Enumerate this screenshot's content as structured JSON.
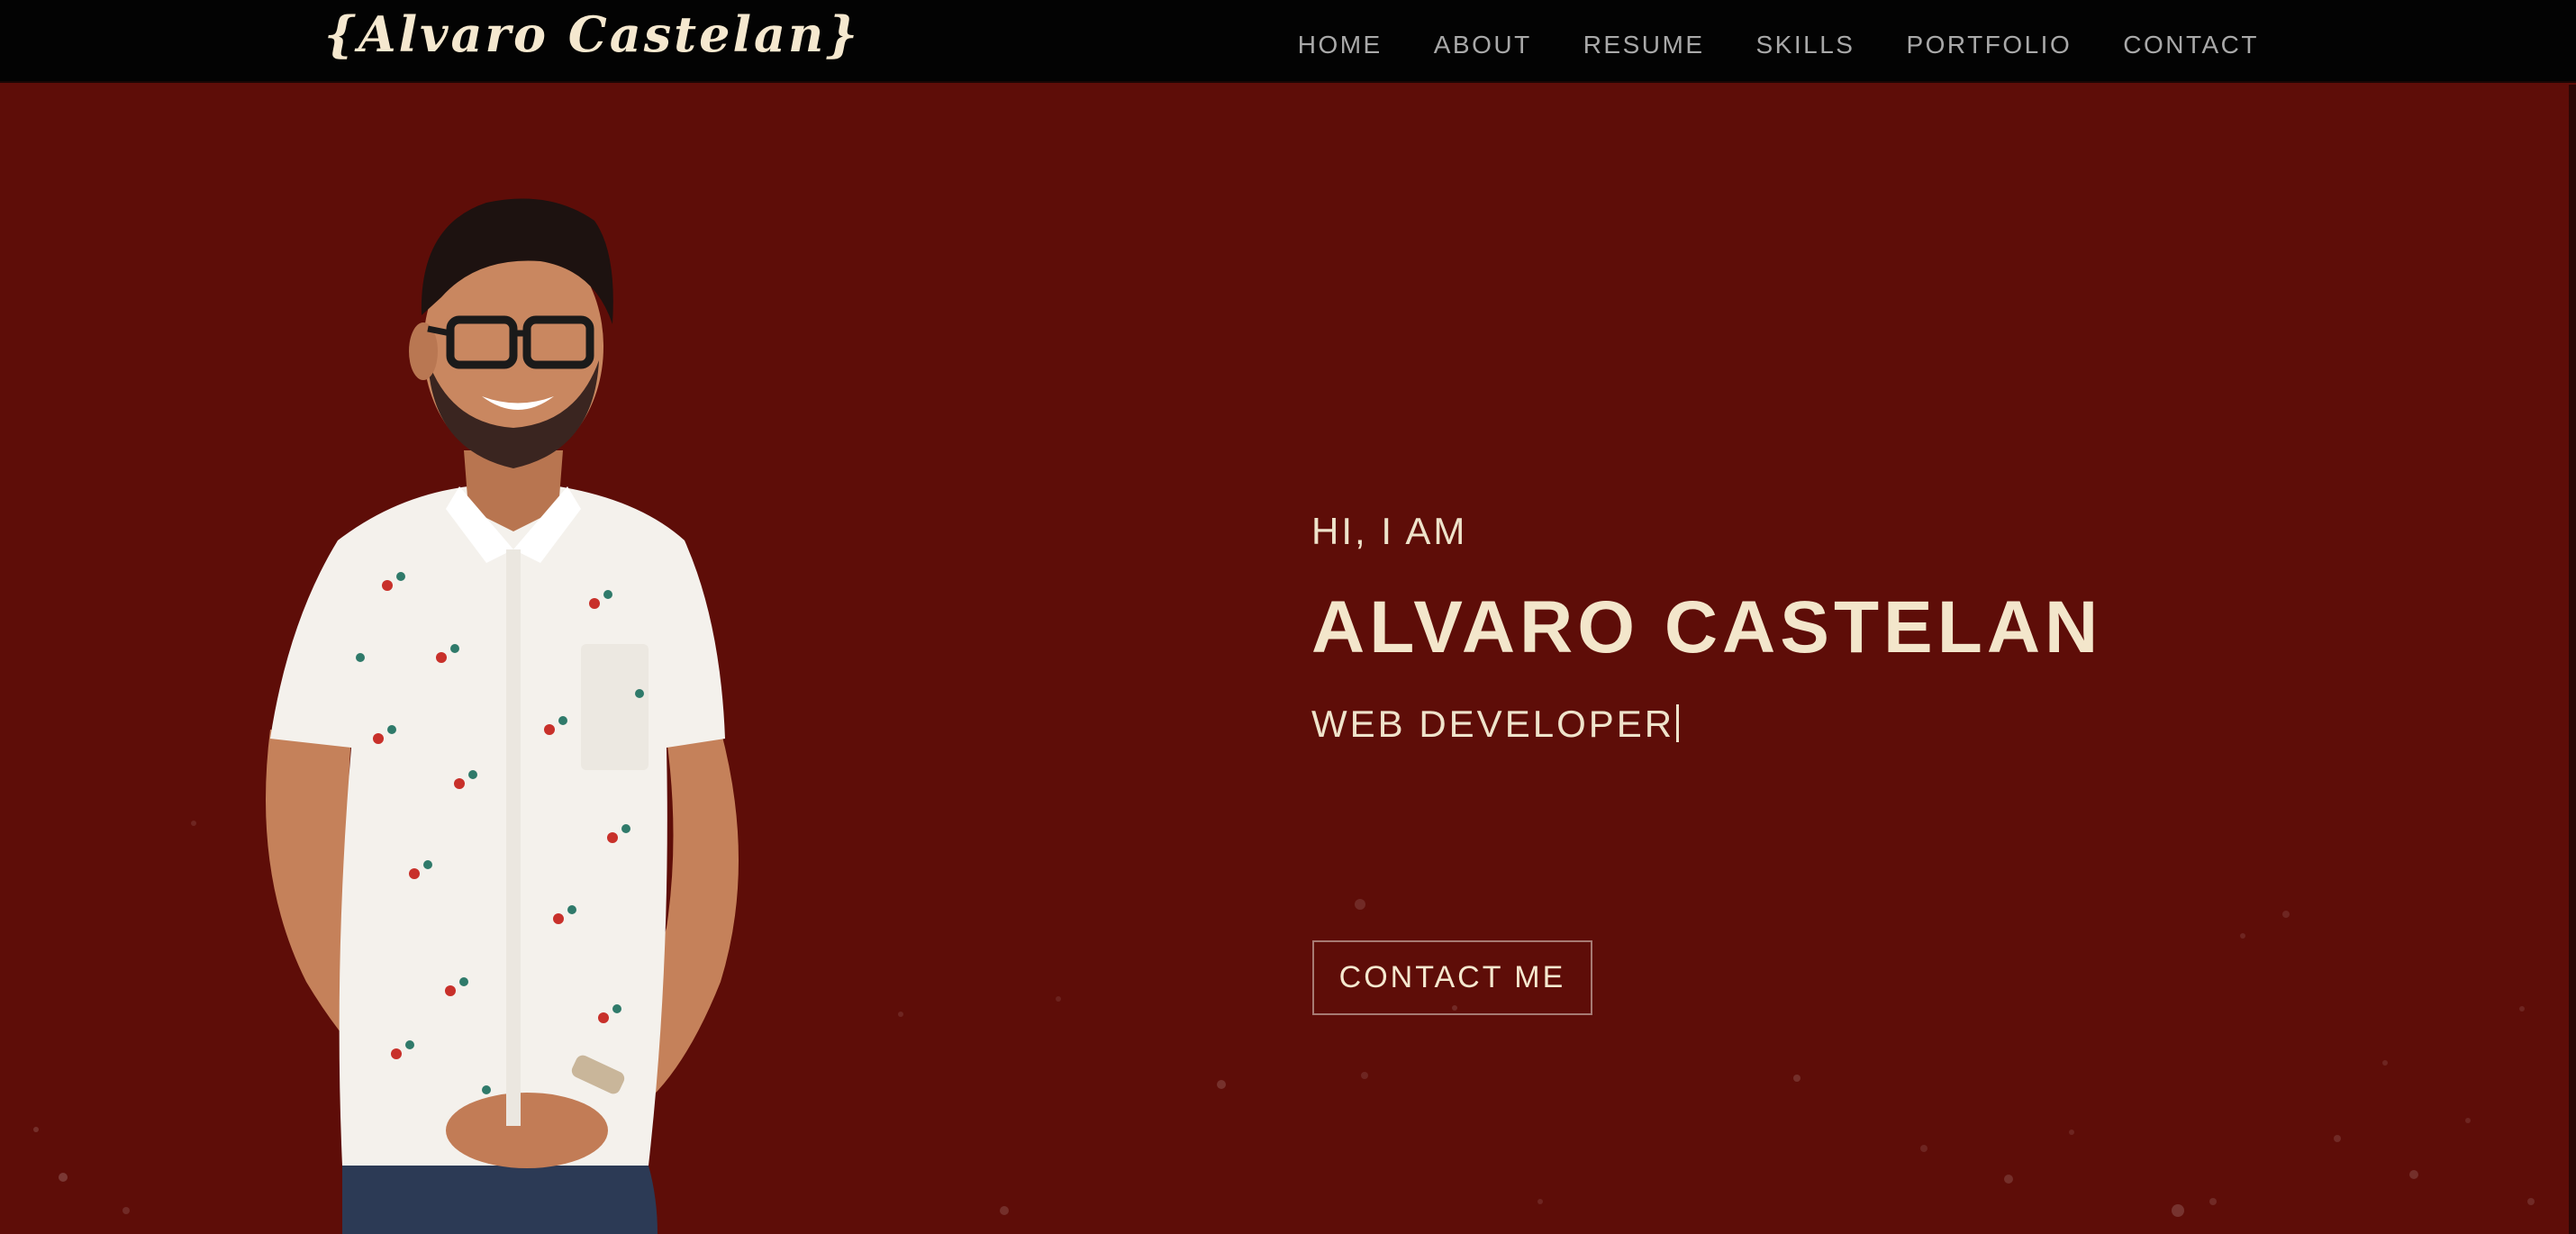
{
  "header": {
    "logo": "{Alvaro Castelan}",
    "nav": [
      {
        "label": "HOME"
      },
      {
        "label": "ABOUT"
      },
      {
        "label": "RESUME"
      },
      {
        "label": "SKILLS"
      },
      {
        "label": "PORTFOLIO"
      },
      {
        "label": "CONTACT"
      }
    ]
  },
  "hero": {
    "greeting": "HI, I AM",
    "name": "ALVARO CASTELAN",
    "role": "WEB DEVELOPER",
    "cta_label": "CONTACT ME"
  },
  "colors": {
    "background": "#5e0d08",
    "navbar": "#030303",
    "text": "#f3e6cb",
    "nav_text": "#a9a9a9"
  }
}
